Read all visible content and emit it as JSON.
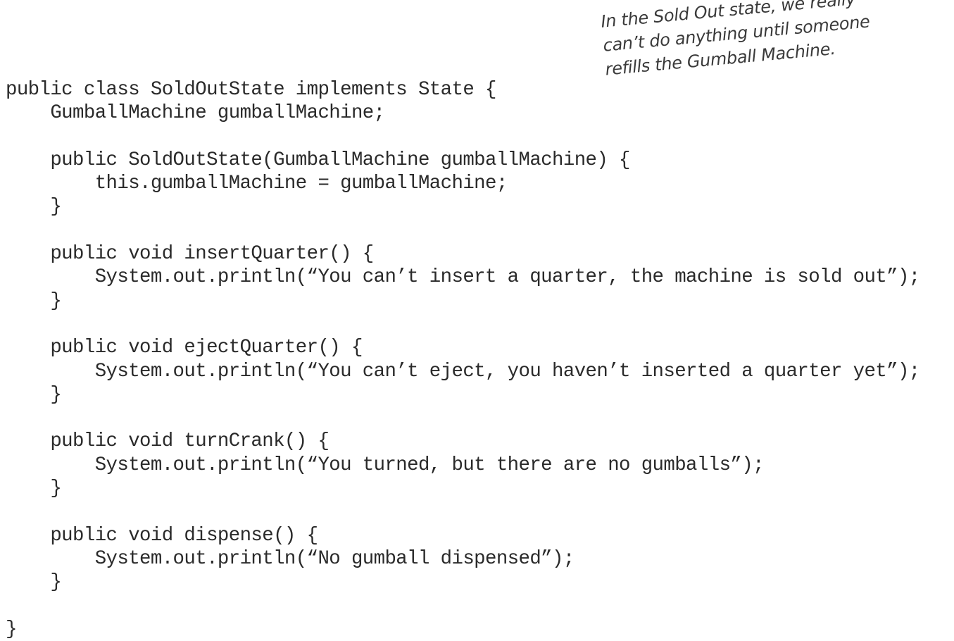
{
  "annotation": {
    "lines": [
      "In the Sold Out state, we really",
      "can’t do anything until someone",
      "refills the Gumball Machine."
    ]
  },
  "code": {
    "lines": [
      "public class SoldOutState implements State {",
      "    GumballMachine gumballMachine;",
      "",
      "    public SoldOutState(GumballMachine gumballMachine) {",
      "        this.gumballMachine = gumballMachine;",
      "    }",
      "",
      "    public void insertQuarter() {",
      "        System.out.println(“You can’t insert a quarter, the machine is sold out”);",
      "    }",
      "",
      "    public void ejectQuarter() {",
      "        System.out.println(“You can’t eject, you haven’t inserted a quarter yet”);",
      "    }",
      "",
      "    public void turnCrank() {",
      "        System.out.println(“You turned, but there are no gumballs”);",
      "    }",
      "",
      "    public void dispense() {",
      "        System.out.println(“No gumball dispensed”);",
      "    }",
      "",
      "}"
    ]
  }
}
